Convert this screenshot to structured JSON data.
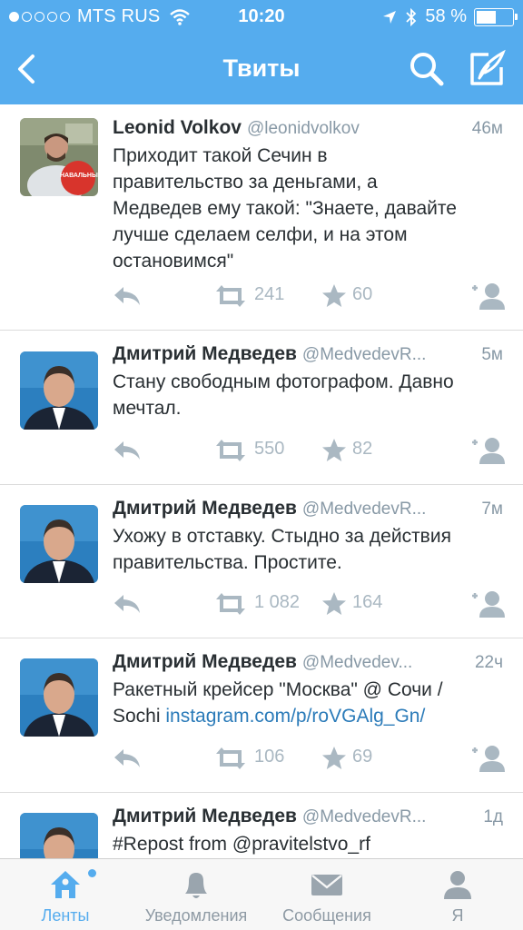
{
  "status_bar": {
    "carrier": "MTS RUS",
    "time": "10:20",
    "battery": "58 %",
    "battery_level": 0.58
  },
  "nav": {
    "title": "Твиты",
    "back_icon": "back-chevron-icon",
    "search_icon": "search-icon",
    "compose_icon": "compose-tweet-icon"
  },
  "colors": {
    "accent": "#55acee",
    "text": "#292f33",
    "muted": "#8899a6",
    "link": "#2b7bb9",
    "actions": "#aab8c2"
  },
  "tweets": [
    {
      "name": "Leonid Volkov",
      "handle": "@leonidvolkov",
      "time": "46м",
      "lines": [
        "Приходит такой Сечин в",
        "правительство за деньгами, а",
        "Медведев ему такой: \"Знаете, давайте",
        "лучше сделаем селфи, и на этом",
        "остановимся\""
      ],
      "retweets": "241",
      "favorites": "60",
      "avatar_badge": "НАВАЛЬНЫЙ"
    },
    {
      "name": "Дмитрий Медведев",
      "handle": "@MedvedevR...",
      "time": "5м",
      "lines": [
        "Стану свободным фотографом. Давно",
        "мечтал."
      ],
      "retweets": "550",
      "favorites": "82"
    },
    {
      "name": "Дмитрий Медведев",
      "handle": "@MedvedevR...",
      "time": "7м",
      "lines": [
        "Ухожу в отставку. Стыдно за действия",
        "правительства. Простите."
      ],
      "retweets": "1 082",
      "favorites": "164"
    },
    {
      "name": "Дмитрий Медведев",
      "handle": "@Medvedev...",
      "time": "22ч",
      "lines": [
        "Ракетный крейсер \"Москва\" @ Сочи /"
      ],
      "line2_prefix": "Sochi ",
      "link": "instagram.com/p/roVGAlg_Gn/",
      "retweets": "106",
      "favorites": "69"
    },
    {
      "name": "Дмитрий Медведев",
      "handle": "@MedvedevR...",
      "time": "1д",
      "lines": [
        "#Repost from @pravitelstvo_rf"
      ]
    }
  ],
  "tabs": [
    {
      "label": "Ленты",
      "icon": "home-icon",
      "active": true
    },
    {
      "label": "Уведомления",
      "icon": "bell-icon",
      "active": false
    },
    {
      "label": "Сообщения",
      "icon": "envelope-icon",
      "active": false
    },
    {
      "label": "Я",
      "icon": "profile-icon",
      "active": false
    }
  ]
}
